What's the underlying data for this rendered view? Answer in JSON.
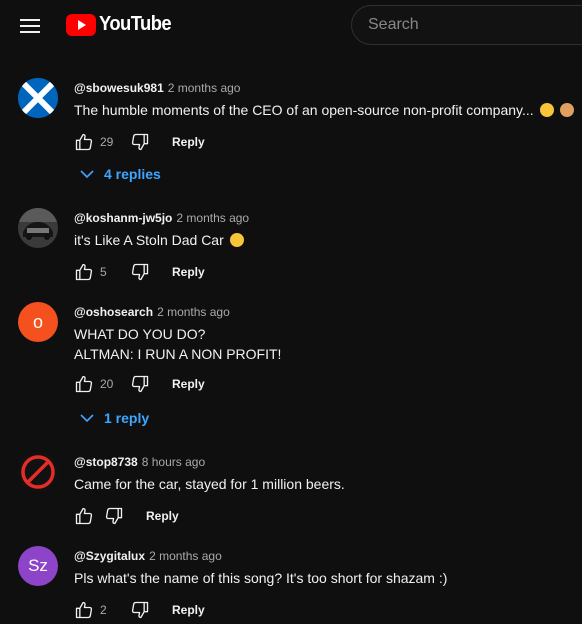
{
  "app": {
    "logo_text": "YouTube",
    "brand_color": "#ff0000"
  },
  "header": {
    "search_placeholder": "Search",
    "menu_icon": "hamburger-menu-icon"
  },
  "comments": [
    {
      "author": "@sbowesuk981",
      "time": "2 months ago",
      "text": "The humble moments of the CEO of an open-source non-profit company...",
      "likes": "29",
      "reply_label": "Reply",
      "replies_label": "4 replies",
      "avatar": "scotland-flag-avatar",
      "emojis": [
        "thinking-face",
        "person-facepalming"
      ]
    },
    {
      "author": "@koshanm-jw5jo",
      "time": "2 months ago",
      "text": "it's Like A Stoln Dad Car",
      "likes": "5",
      "reply_label": "Reply",
      "avatar": "car-photo-avatar",
      "emojis": [
        "face-with-tears-of-joy"
      ]
    },
    {
      "author": "@oshosearch",
      "time": "2 months ago",
      "text_lines": [
        "WHAT DO YOU DO?",
        "ALTMAN: I RUN A NON PROFIT!"
      ],
      "likes": "20",
      "reply_label": "Reply",
      "replies_label": "1 reply",
      "avatar_letter": "o",
      "avatar_color": "#f4511e"
    },
    {
      "author": "@stop8738",
      "time": "8 hours ago",
      "text": "Came for the car, stayed for 1 million beers.",
      "likes": "",
      "reply_label": "Reply",
      "avatar": "no-sign-avatar"
    },
    {
      "author": "@Szygitalux",
      "time": "2 months ago",
      "text": "Pls what's the name of this song? It's too short for shazam :)",
      "likes": "2",
      "reply_label": "Reply",
      "avatar_letter": "Sz",
      "avatar_color": "#8e44c9"
    }
  ]
}
